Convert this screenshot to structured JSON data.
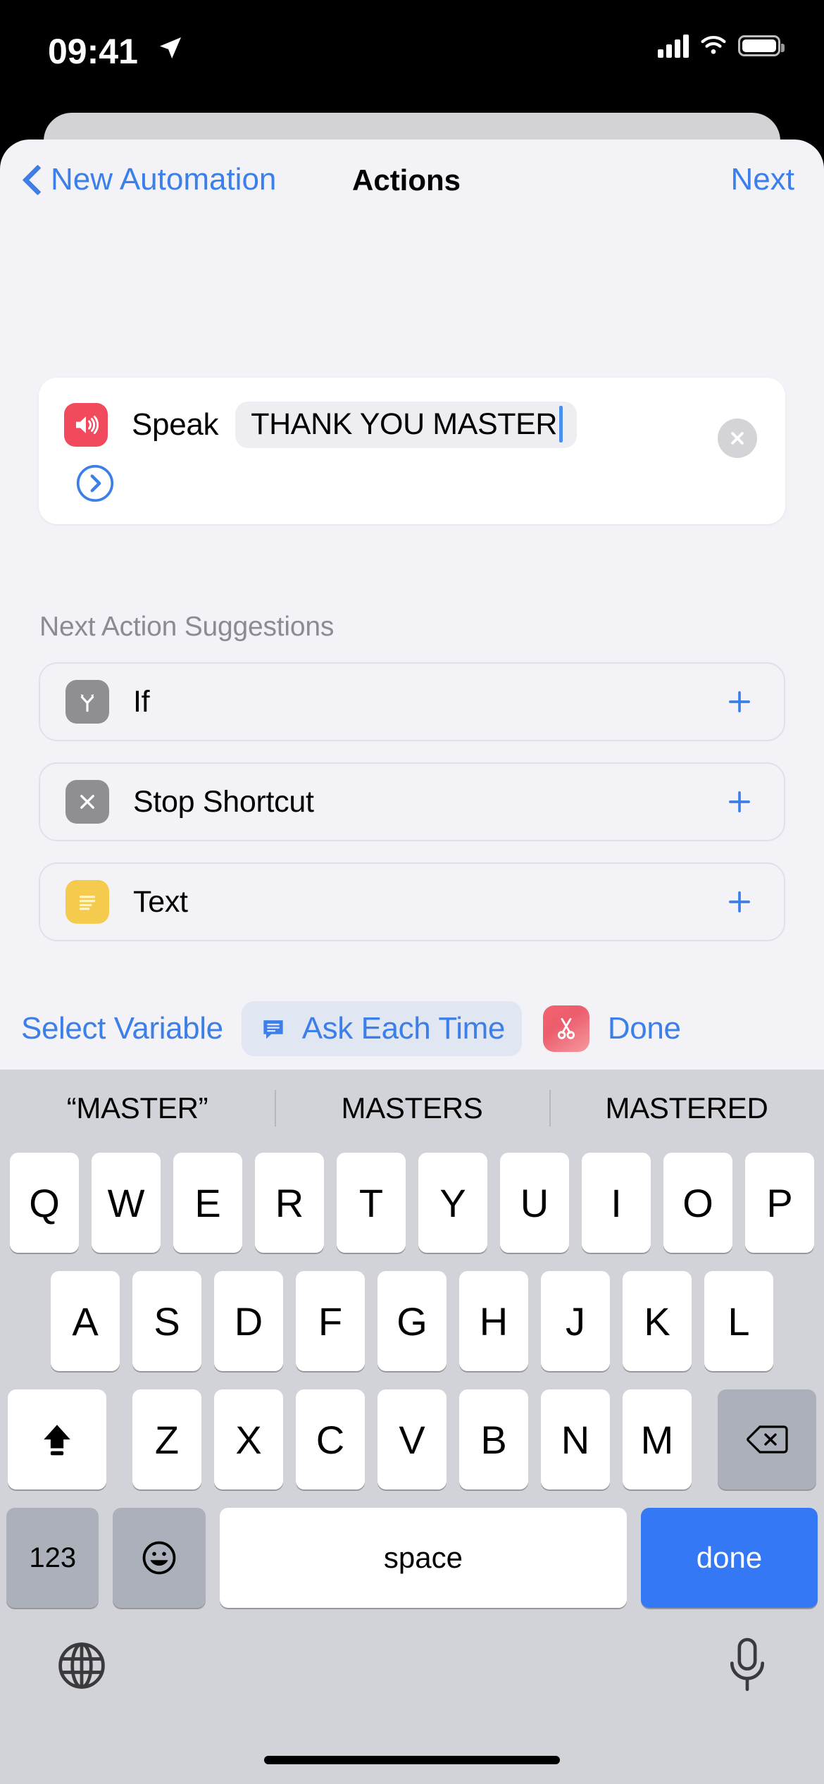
{
  "status_bar": {
    "time": "09:41",
    "location_icon": "location-arrow-icon",
    "signal_icon": "cellular-signal-icon",
    "wifi_icon": "wifi-icon",
    "battery_icon": "battery-icon"
  },
  "nav": {
    "back_label": "New Automation",
    "title": "Actions",
    "next_label": "Next",
    "back_icon": "chevron-left-icon"
  },
  "action_card": {
    "icon": "speaker-wave-icon",
    "icon_color": "#f04a5c",
    "label": "Speak",
    "field_value": "THANK YOU MASTER",
    "close_icon": "close-circle-icon",
    "expand_icon": "chevron-right-circle-icon"
  },
  "suggestions": {
    "header": "Next Action Suggestions",
    "items": [
      {
        "label": "If",
        "icon": "branch-fork-icon",
        "icon_color": "#8e8e93",
        "add_icon": "plus-icon"
      },
      {
        "label": "Stop Shortcut",
        "icon": "x-mark-icon",
        "icon_color": "#8e8e93",
        "add_icon": "plus-icon"
      },
      {
        "label": "Text",
        "icon": "text-lines-icon",
        "icon_color": "#f5cb4e",
        "add_icon": "plus-icon"
      }
    ]
  },
  "toolbar": {
    "select_variable": "Select Variable",
    "ask_each_time": "Ask Each Time",
    "ask_icon": "speech-bubble-icon",
    "shortcuts_icon": "scissors-icon",
    "done": "Done",
    "accent_color": "#3c7fe8"
  },
  "keyboard": {
    "suggestions": [
      "“MASTER”",
      "MASTERS",
      "MASTERED"
    ],
    "row1": [
      "Q",
      "W",
      "E",
      "R",
      "T",
      "Y",
      "U",
      "I",
      "O",
      "P"
    ],
    "row2": [
      "A",
      "S",
      "D",
      "F",
      "G",
      "H",
      "J",
      "K",
      "L"
    ],
    "row3": [
      "Z",
      "X",
      "C",
      "V",
      "B",
      "N",
      "M"
    ],
    "shift_icon": "shift-lock-icon",
    "delete_icon": "backspace-icon",
    "numbers_label": "123",
    "emoji_icon": "emoji-smiley-icon",
    "space_label": "space",
    "done_label": "done",
    "globe_icon": "globe-icon",
    "mic_icon": "microphone-icon",
    "done_key_color": "#3478f6"
  }
}
